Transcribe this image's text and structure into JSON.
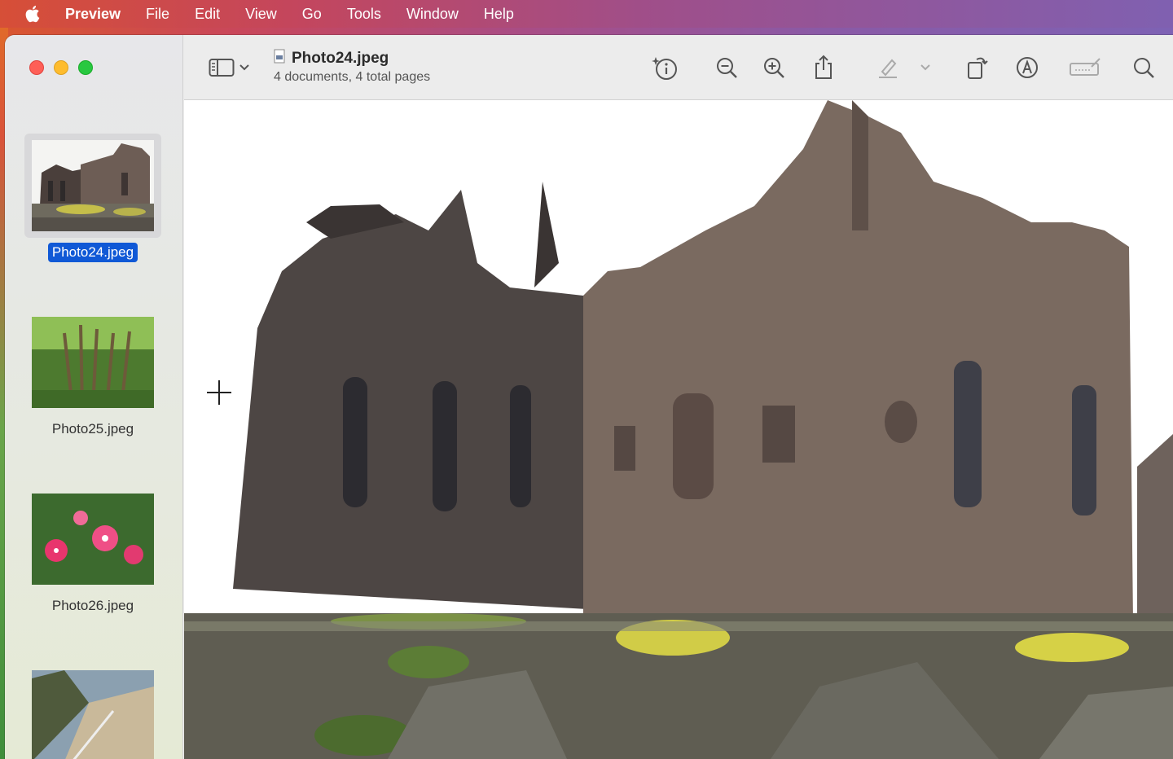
{
  "menubar": {
    "apple_icon": "apple-icon",
    "items": [
      "Preview",
      "File",
      "Edit",
      "View",
      "Go",
      "Tools",
      "Window",
      "Help"
    ]
  },
  "window": {
    "document_title": "Photo24.jpeg",
    "document_subtitle": "4 documents, 4 total pages"
  },
  "toolbar": {
    "icons": [
      "sidebar-icon",
      "chevron-down-icon",
      "info-icon",
      "zoom-out-icon",
      "zoom-in-icon",
      "share-icon",
      "highlight-icon",
      "chevron-down-icon",
      "rotate-icon",
      "markup-icon",
      "sign-icon",
      "search-icon"
    ]
  },
  "sidebar": {
    "thumbnails": [
      {
        "label": "Photo24.jpeg",
        "selected": true
      },
      {
        "label": "Photo25.jpeg",
        "selected": false
      },
      {
        "label": "Photo26.jpeg",
        "selected": false
      },
      {
        "label": "",
        "selected": false
      }
    ]
  },
  "colors": {
    "selection": "#1059d6",
    "close": "#fe5f57",
    "minimize": "#febc2e",
    "maximize": "#28c840"
  }
}
